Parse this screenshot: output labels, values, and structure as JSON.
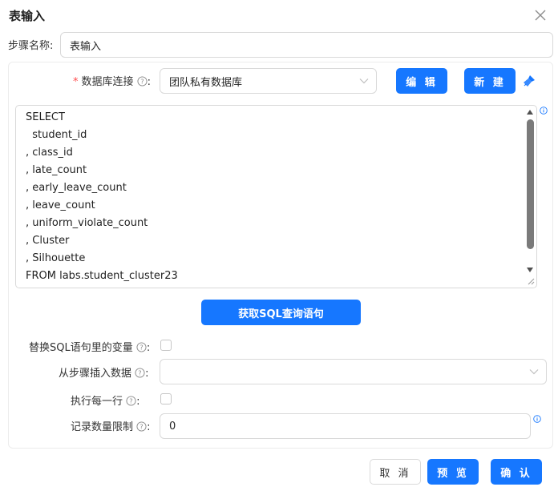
{
  "dialog": {
    "title": "表输入"
  },
  "step_name": {
    "label": "步骤名称:",
    "value": "表输入"
  },
  "db": {
    "required_mark": "*",
    "label": "数据库连接",
    "colon": ":",
    "value": "团队私有数据库",
    "edit_label": "编 辑",
    "new_label": "新 建"
  },
  "sql": {
    "lines": [
      "SELECT",
      "  student_id",
      ", class_id",
      ", late_count",
      ", early_leave_count",
      ", leave_count",
      ", uniform_violate_count",
      ", Cluster",
      ", Silhouette",
      "FROM labs.student_cluster23"
    ],
    "get_sql_label": "获取SQL查询语句"
  },
  "replace_vars": {
    "label": "替换SQL语句里的变量",
    "colon": ":"
  },
  "insert_from_step": {
    "label": "从步骤插入数据",
    "colon": ":",
    "value": ""
  },
  "execute_each_row": {
    "label": "执行每一行",
    "colon": ":"
  },
  "limit": {
    "label": "记录数量限制",
    "colon": ":",
    "value": "0"
  },
  "footer": {
    "cancel": "取 消",
    "preview": "预 览",
    "confirm": "确 认"
  },
  "colors": {
    "primary": "#1677ff",
    "required": "#ff4d4f",
    "border": "#d9d9d9"
  }
}
